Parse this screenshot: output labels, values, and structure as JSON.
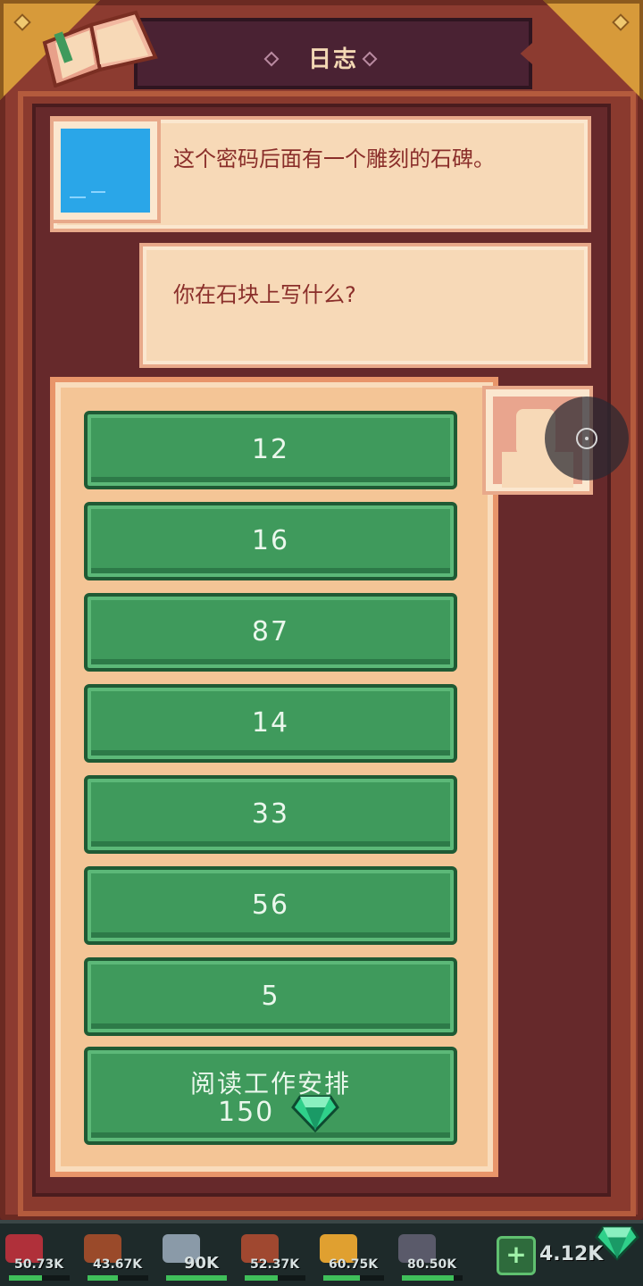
{
  "header": {
    "title": "日志"
  },
  "dialog": {
    "line1": "这个密码后面有一个雕刻的石碑。",
    "line2": "你在石块上写什么?"
  },
  "choices": [
    {
      "label": "12"
    },
    {
      "label": "16"
    },
    {
      "label": "87"
    },
    {
      "label": "14"
    },
    {
      "label": "33"
    },
    {
      "label": "56"
    },
    {
      "label": "5"
    }
  ],
  "special_choice": {
    "label": "阅读工作安排",
    "cost": "150"
  },
  "resources": [
    {
      "icon": "meat-icon",
      "value": "50.73K",
      "color": "#b0303a",
      "fill": 0.55
    },
    {
      "icon": "wood-icon",
      "value": "43.67K",
      "color": "#9a4a2a",
      "fill": 0.5
    },
    {
      "icon": "stone-icon",
      "value": "90K",
      "color": "#8a9aa8",
      "fill": 1.0
    },
    {
      "icon": "leather-icon",
      "value": "52.37K",
      "color": "#a04830",
      "fill": 0.55
    },
    {
      "icon": "gold-icon",
      "value": "60.75K",
      "color": "#e0a030",
      "fill": 0.6
    },
    {
      "icon": "ore-icon",
      "value": "80.50K",
      "color": "#5a5a6a",
      "fill": 0.85
    }
  ],
  "gems": {
    "value": "4.12K",
    "plus_label": "+"
  }
}
